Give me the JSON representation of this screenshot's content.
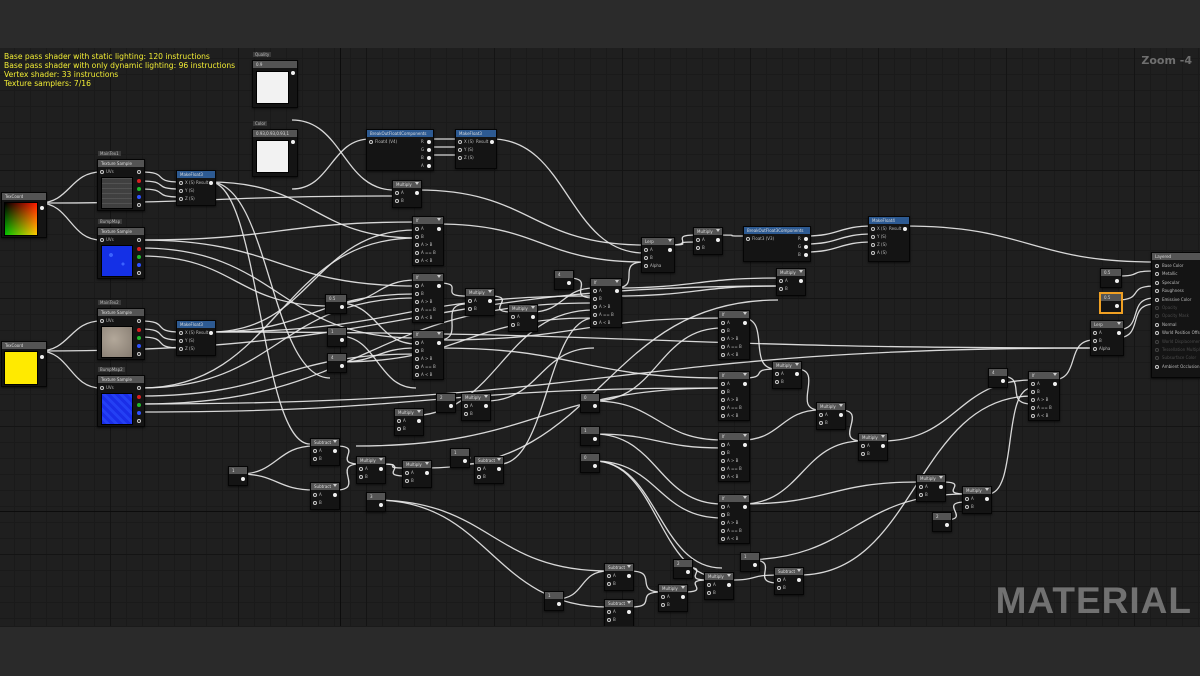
{
  "stats": {
    "line1": "Base pass shader with static lighting: 120 instructions",
    "line2": "Base pass shader with only dynamic lighting: 96 instructions",
    "line3": "Vertex shader: 33 instructions",
    "line4": "Texture samplers: 7/16"
  },
  "zoom_label": "Zoom -4",
  "watermark": "MATERIAL",
  "nodes": {
    "texcoord1": {
      "title": "TexCoord"
    },
    "texcoord2": {
      "title": "TexCoord"
    },
    "mainTex1": {
      "title": "Texture Sample",
      "param": "MainTex1",
      "uvs": "UVs"
    },
    "bumpMap1": {
      "title": "Texture Sample",
      "param": "BumpMap",
      "uvs": "UVs"
    },
    "mainTex2": {
      "title": "Texture Sample",
      "param": "MainTex2",
      "uvs": "UVs"
    },
    "bumpMap2": {
      "title": "Texture Sample",
      "param": "BumpMap2",
      "uvs": "UVs"
    },
    "makeFloat3a": {
      "title": "MakeFloat3",
      "x": "X (S)",
      "y": "Y (S)",
      "z": "Z (S)",
      "result": "Result"
    },
    "makeFloat3b": {
      "title": "MakeFloat3",
      "x": "X (S)",
      "y": "Y (S)",
      "z": "Z (S)",
      "result": "Result"
    },
    "quality": {
      "param": "Quality",
      "value": "0.9"
    },
    "color": {
      "param": "Color",
      "value": "0.93,0.93,0.93,1"
    },
    "breakOut1": {
      "title": "BreakOutFloat4Components",
      "input": "Float4 (V4)",
      "r": "R",
      "g": "G",
      "b": "B",
      "a": "A"
    },
    "makeFloat3c": {
      "title": "MakeFloat3",
      "x": "X (S)",
      "y": "Y (S)",
      "z": "Z (S)",
      "result": "Result"
    },
    "multiplyTop": {
      "title": "Multiply",
      "a": "A",
      "b": "B"
    },
    "lerp1": {
      "title": "Lerp",
      "a": "A",
      "b": "B",
      "alpha": "Alpha"
    },
    "multiply2": {
      "title": "Multiply",
      "a": "A",
      "b": "B"
    },
    "breakOut2": {
      "title": "BreakOutFloat3Components",
      "input": "Float3 (V3)",
      "r": "R",
      "g": "G",
      "b": "B"
    },
    "makeFloat4": {
      "title": "MakeFloat4",
      "x": "X (S)",
      "y": "Y (S)",
      "z": "Z (S)",
      "a": "A (S)",
      "result": "Result"
    },
    "multiply3": {
      "title": "Multiply",
      "a": "A",
      "b": "B"
    },
    "const05a": {
      "value": "0.5"
    },
    "const05b": {
      "value": "0.5"
    },
    "const05sel": {
      "value": "0.5"
    },
    "const1": {
      "value": "1"
    },
    "const2": {
      "value": "2"
    },
    "const3": {
      "value": "3"
    },
    "const4": {
      "value": "4"
    },
    "const0": {
      "value": "0"
    },
    "lerp2": {
      "title": "Lerp",
      "a": "A",
      "b": "B",
      "alpha": "Alpha"
    },
    "subtract": {
      "title": "Subtract"
    },
    "multiply": {
      "title": "Multiply"
    },
    "ifNode": {
      "title": "If",
      "a": "A",
      "b": "B",
      "gt": "A > B",
      "eq": "A == B",
      "lt": "A < B"
    },
    "material": {
      "title": "Layered",
      "inputs": [
        "Base Color",
        "Metallic",
        "Specular",
        "Roughness",
        "Emissive Color",
        "Opacity",
        "Opacity Mask",
        "Normal",
        "World Position Offset",
        "World Displacement",
        "Tessellation Multiplier",
        "Subsurface Color",
        "Ambient Occlusion"
      ],
      "active": [
        true,
        true,
        true,
        true,
        true,
        false,
        false,
        true,
        true,
        false,
        false,
        false,
        true
      ]
    }
  },
  "colors": {
    "background": "#1f1f1f",
    "stats_text": "#f3ee35",
    "node_header": "#545454",
    "node_header_blue": "#2d5a92",
    "selection": "#f0a023",
    "wire": "#e8e8e8",
    "pin_red": "#d62020",
    "pin_green": "#1fb82c",
    "pin_blue": "#2f52ff"
  }
}
